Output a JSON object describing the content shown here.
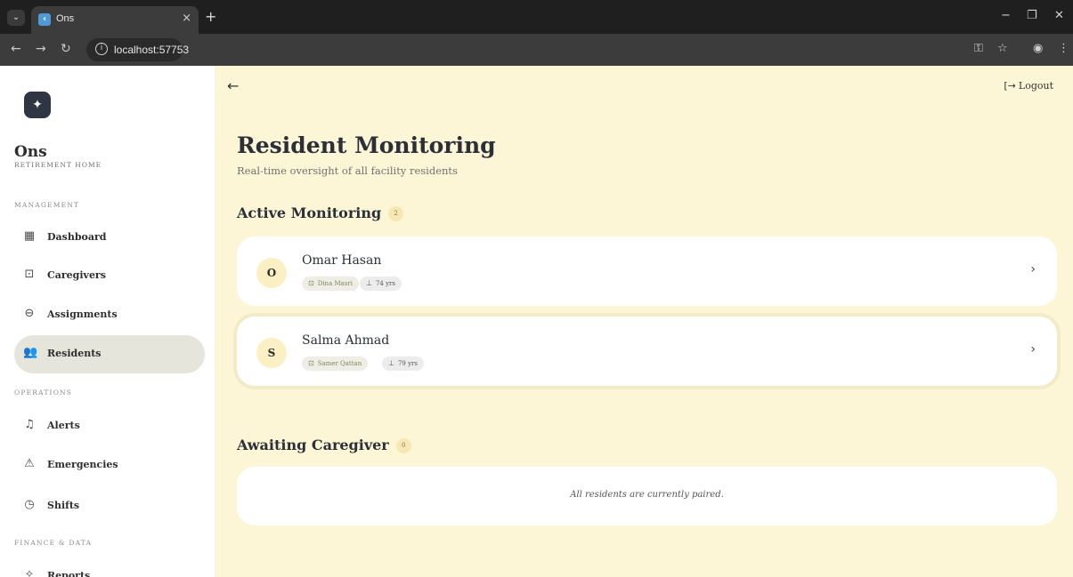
{
  "browser": {
    "tab_title": "Ons",
    "tab_close": "×",
    "new_tab": "+",
    "url": "localhost:57753",
    "icons": [
      "tab-menu-icon",
      "favicon",
      "back-icon",
      "forward-icon",
      "reload-icon",
      "info-icon",
      "key-icon",
      "star-icon",
      "profile-icon",
      "more-icon",
      "minimize-icon",
      "restore-icon",
      "close-icon"
    ]
  },
  "sidebar": {
    "brand_name": "Ons",
    "brand_sub": "RETIREMENT HOME",
    "sections": {
      "management": "MANAGEMENT",
      "operations": "OPERATIONS",
      "finance": "FINANCE & DATA"
    },
    "items": [
      {
        "label": "Dashboard",
        "icon": "grid-icon"
      },
      {
        "label": "Caregivers",
        "icon": "badge-icon"
      },
      {
        "label": "Assignments",
        "icon": "link-icon"
      },
      {
        "label": "Residents",
        "icon": "people-icon",
        "active": true
      },
      {
        "label": "Alerts",
        "icon": "bell-icon"
      },
      {
        "label": "Emergencies",
        "icon": "warning-icon"
      },
      {
        "label": "Shifts",
        "icon": "clock-icon"
      },
      {
        "label": "Reports",
        "icon": "sparkle-icon"
      }
    ]
  },
  "header": {
    "logout_label": "Logout"
  },
  "main": {
    "title": "Resident Monitoring",
    "subtitle": "Real-time oversight of all facility residents",
    "active_section": {
      "title": "Active Monitoring",
      "count": "2"
    },
    "residents": [
      {
        "initial": "O",
        "name": "Omar Hasan",
        "caregiver": "Dina Masri",
        "age": "74 yrs"
      },
      {
        "initial": "S",
        "name": "Salma Ahmad",
        "caregiver": "Samer Qattan",
        "age": "79 yrs"
      }
    ],
    "awaiting_section": {
      "title": "Awaiting Caregiver",
      "count": "0"
    },
    "empty_message": "All residents are currently paired."
  },
  "colors": {
    "page_bg": "#fdf6d6",
    "sidebar_bg": "#ffffff",
    "active_nav_bg": "#e5e5dc",
    "logo_bg": "#2f3542",
    "avatar_bg": "#fbf0c4"
  }
}
